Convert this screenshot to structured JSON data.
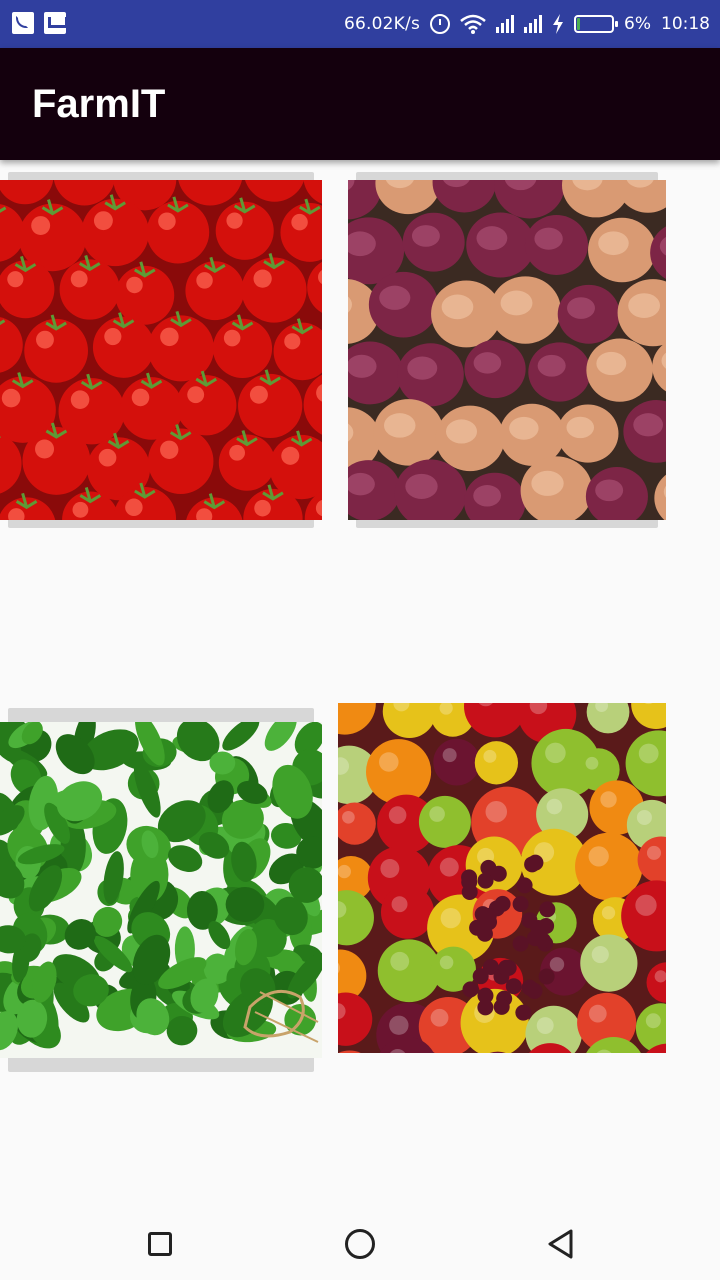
{
  "status_bar": {
    "network_speed": "66.02K/s",
    "battery_percent": "6%",
    "time": "10:18",
    "icons": [
      "cast-icon",
      "gmail-icon",
      "alarm-icon",
      "wifi-icon",
      "signal-icon",
      "signal-icon",
      "charging-icon",
      "battery-icon"
    ],
    "battery_level": 0.06,
    "background_color": "#303f9f"
  },
  "app_bar": {
    "title": "FarmIT",
    "background_color": "#14000d"
  },
  "products": [
    {
      "image": "tomatoes-image",
      "icon": "tomatoes"
    },
    {
      "image": "onions-image",
      "icon": "onions"
    },
    {
      "image": "coriander-image",
      "icon": "coriander"
    },
    {
      "image": "fruits-image",
      "icon": "mixed-fruits"
    }
  ],
  "nav_bar": {
    "icons": [
      "recents-square-icon",
      "home-circle-icon",
      "back-triangle-icon"
    ]
  }
}
